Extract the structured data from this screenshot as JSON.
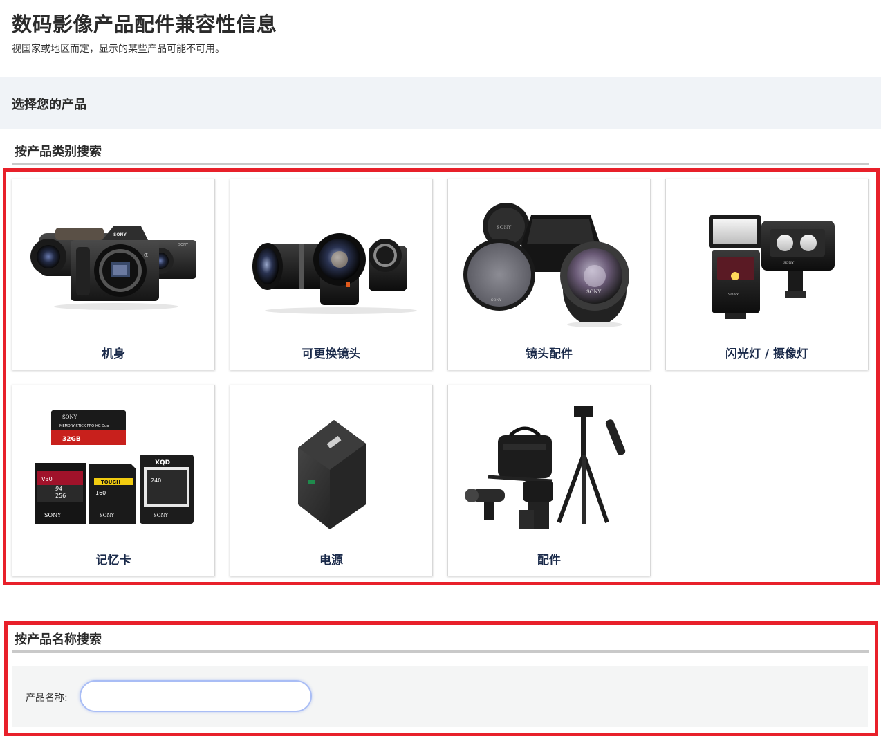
{
  "header": {
    "title": "数码影像产品配件兼容性信息",
    "subtitle": "视国家或地区而定，显示的某些产品可能不可用。"
  },
  "select_banner": {
    "label": "选择您的产品"
  },
  "category_search": {
    "heading": "按产品类别搜索",
    "categories": [
      {
        "label": "机身",
        "icon": "camera-bodies-icon"
      },
      {
        "label": "可更换镜头",
        "icon": "interchangeable-lenses-icon"
      },
      {
        "label": "镜头配件",
        "icon": "lens-accessories-icon"
      },
      {
        "label": "闪光灯 / 摄像灯",
        "icon": "flash-video-light-icon"
      },
      {
        "label": "记忆卡",
        "icon": "memory-cards-icon"
      },
      {
        "label": "电源",
        "icon": "battery-icon"
      },
      {
        "label": "配件",
        "icon": "accessories-icon"
      }
    ],
    "thumb_text": {
      "brand": "SONY",
      "ms_line": "MEMORY STICK PRO-HG Duo",
      "ms_capacity": "32GB",
      "sd_v30": "V30",
      "sd_speed": "94",
      "sd_capacity": "256",
      "tough": "TOUGH",
      "tough_capacity": "160",
      "xqd": "XQD",
      "xqd_capacity": "240",
      "alpha": "α"
    }
  },
  "name_search": {
    "heading": "按产品名称搜索",
    "label": "产品名称:",
    "value": "",
    "placeholder": ""
  },
  "colors": {
    "highlight": "#e8202a",
    "banner_bg": "#f0f3f7",
    "label_text": "#1a2a4a",
    "input_border": "#a9bdf5"
  }
}
